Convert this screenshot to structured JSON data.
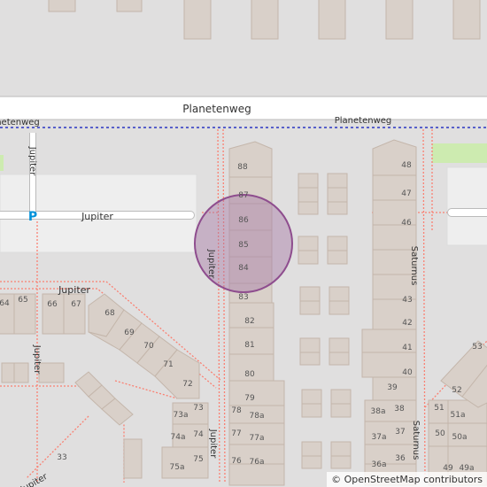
{
  "map": {
    "colors": {
      "background": "#e0dfdf",
      "building": "#d9d0c9",
      "building_stroke": "#c4b6ab",
      "road": "#ffffff",
      "road_casing": "#bbbbbb",
      "boundary": "#2b37c4",
      "footpath": "#fa8072",
      "grass": "#cdebb0",
      "marker_fill": "#a779a7",
      "marker_stroke": "#8e4d8e",
      "parking": "#0092da",
      "label": "#333333"
    },
    "streets": {
      "planetenweg_main": "Planetenweg",
      "planetenweg_left": "netenweg",
      "planetenweg_right": "Planetenweg",
      "jupiter_road": "Jupiter",
      "jupiter_top_left": "Jupiter",
      "jupiter_mid": "Jupiter",
      "jupiter_left_vertical": "Jupiter",
      "jupiter_lower_left": "Jupiter",
      "jupiter_bottom": "Jupiter",
      "jupiter_corner": "Jupiter",
      "saturnus_upper": "Saturnus",
      "saturnus_lower": "Saturnus"
    },
    "parking_symbol": "P",
    "house_numbers": {
      "n88": "88",
      "n87": "87",
      "n86": "86",
      "n85": "85",
      "n84": "84",
      "n83": "83",
      "n82": "82",
      "n81": "81",
      "n80": "80",
      "n79": "79",
      "n78": "78",
      "n78a": "78a",
      "n77": "77",
      "n77a": "77a",
      "n76": "76",
      "n76a": "76a",
      "n64": "64",
      "n65": "65",
      "n66": "66",
      "n67": "67",
      "n68": "68",
      "n69": "69",
      "n70": "70",
      "n71": "71",
      "n72": "72",
      "n73": "73",
      "n73a": "73a",
      "n74": "74",
      "n74a": "74a",
      "n75": "75",
      "n75a": "75a",
      "n33": "33",
      "n48": "48",
      "n47": "47",
      "n46": "46",
      "n43": "43",
      "n42": "42",
      "n41": "41",
      "n40": "40",
      "n39": "39",
      "n38": "38",
      "n38a": "38a",
      "n37": "37",
      "n37a": "37a",
      "n36": "36",
      "n36a": "36a",
      "n52": "52",
      "n51": "51",
      "n51a": "51a",
      "n50": "50",
      "n50a": "50a",
      "n49": "49",
      "n49a": "49a",
      "n53": "53"
    },
    "attribution": {
      "symbol": "©",
      "text": "OpenStreetMap contributors"
    }
  }
}
